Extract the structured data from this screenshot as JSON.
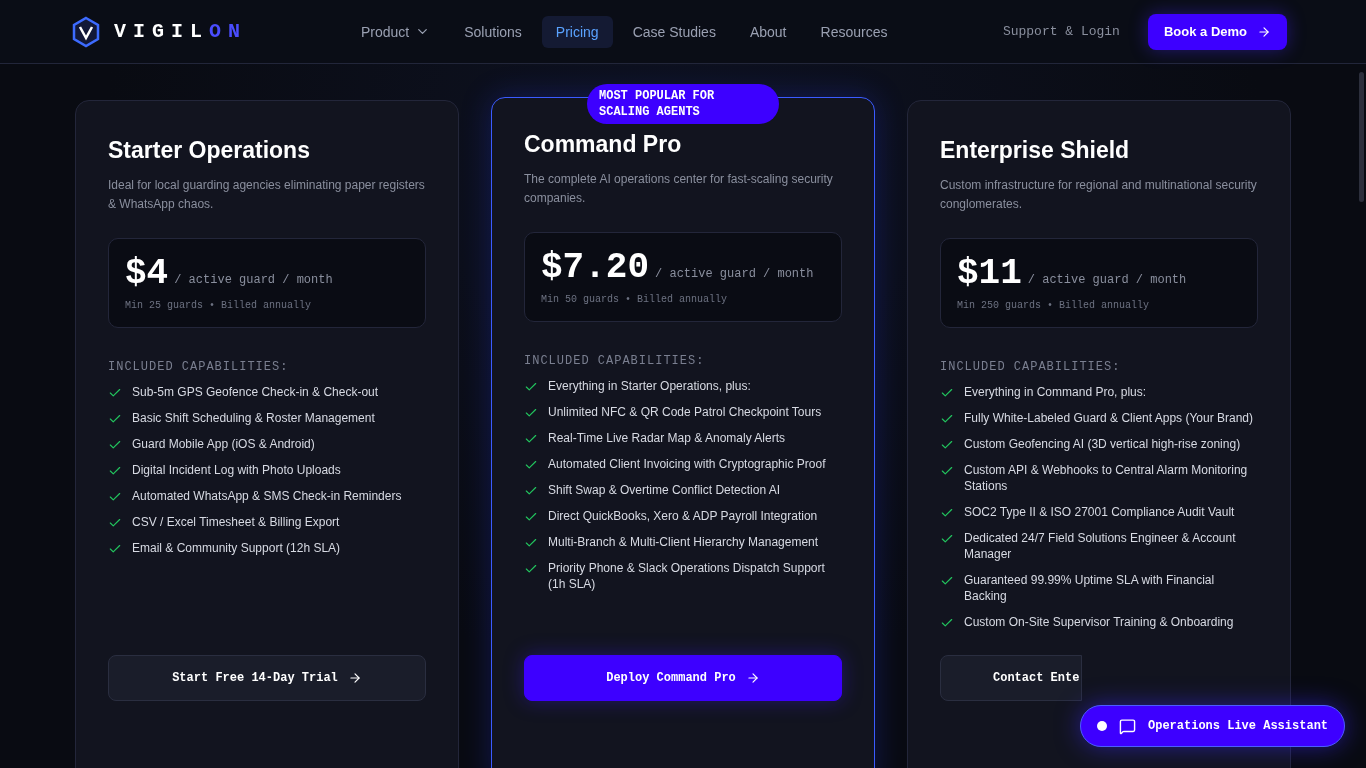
{
  "brand": {
    "main": "VIGIL",
    "accent": "ON"
  },
  "nav": [
    {
      "label": "Product",
      "dropdown": true,
      "selected": false
    },
    {
      "label": "Solutions",
      "dropdown": false,
      "selected": false
    },
    {
      "label": "Pricing",
      "dropdown": false,
      "selected": true
    },
    {
      "label": "Case Studies",
      "dropdown": false,
      "selected": false
    },
    {
      "label": "About",
      "dropdown": false,
      "selected": false
    },
    {
      "label": "Resources",
      "dropdown": false,
      "selected": false
    }
  ],
  "support_link": "Support & Login",
  "demo_button": "Book a Demo",
  "plans": [
    {
      "name": "Starter Operations",
      "featured": false,
      "description": "Ideal for local guarding agencies eliminating paper registers & WhatsApp chaos.",
      "price": "$4",
      "unit": "/ active guard / month",
      "terms": "Min 25 guards • Billed annually",
      "section": "INCLUDED CAPABILITIES:",
      "features": [
        "Sub-5m GPS Geofence Check-in & Check-out",
        "Basic Shift Scheduling & Roster Management",
        "Guard Mobile App (iOS & Android)",
        "Digital Incident Log with Photo Uploads",
        "Automated WhatsApp & SMS Check-in Reminders",
        "CSV / Excel Timesheet & Billing Export",
        "Email & Community Support (12h SLA)"
      ],
      "cta": {
        "label": "Start Free 14-Day Trial",
        "covered": false
      }
    },
    {
      "name": "Command Pro",
      "featured": true,
      "badge": "MOST POPULAR FOR SCALING AGENTS",
      "description": "The complete AI operations center for fast-scaling security companies.",
      "price": "$7.20",
      "unit": "/ active guard / month",
      "terms": "Min 50 guards • Billed annually",
      "section": "INCLUDED CAPABILITIES:",
      "features": [
        "Everything in Starter Operations, plus:",
        "Unlimited NFC & QR Code Patrol Checkpoint Tours",
        "Real-Time Live Radar Map & Anomaly Alerts",
        "Automated Client Invoicing with Cryptographic Proof",
        "Shift Swap & Overtime Conflict Detection AI",
        "Direct QuickBooks, Xero & ADP Payroll Integration",
        "Multi-Branch & Multi-Client Hierarchy Management",
        "Priority Phone & Slack Operations Dispatch Support (1h SLA)"
      ],
      "cta": {
        "label": "Deploy Command Pro",
        "covered": false
      }
    },
    {
      "name": "Enterprise Shield",
      "featured": false,
      "description": "Custom infrastructure for regional and multinational security conglomerates.",
      "price": "$11",
      "unit": "/ active guard / month",
      "terms": "Min 250 guards • Billed annually",
      "section": "INCLUDED CAPABILITIES:",
      "features": [
        "Everything in Command Pro, plus:",
        "Fully White-Labeled Guard & Client Apps (Your Brand)",
        "Custom Geofencing AI (3D vertical high-rise zoning)",
        "Custom API & Webhooks to Central Alarm Monitoring Stations",
        "SOC2 Type II & ISO 27001 Compliance Audit Vault",
        "Dedicated 24/7 Field Solutions Engineer & Account Manager",
        "Guaranteed 99.99% Uptime SLA with Financial Backing",
        "Custom On-Site Supervisor Training & Onboarding"
      ],
      "cta": {
        "label": "Contact Ente",
        "covered": true
      }
    }
  ],
  "assistant": {
    "label": "Operations Live Assistant",
    "online": true
  }
}
